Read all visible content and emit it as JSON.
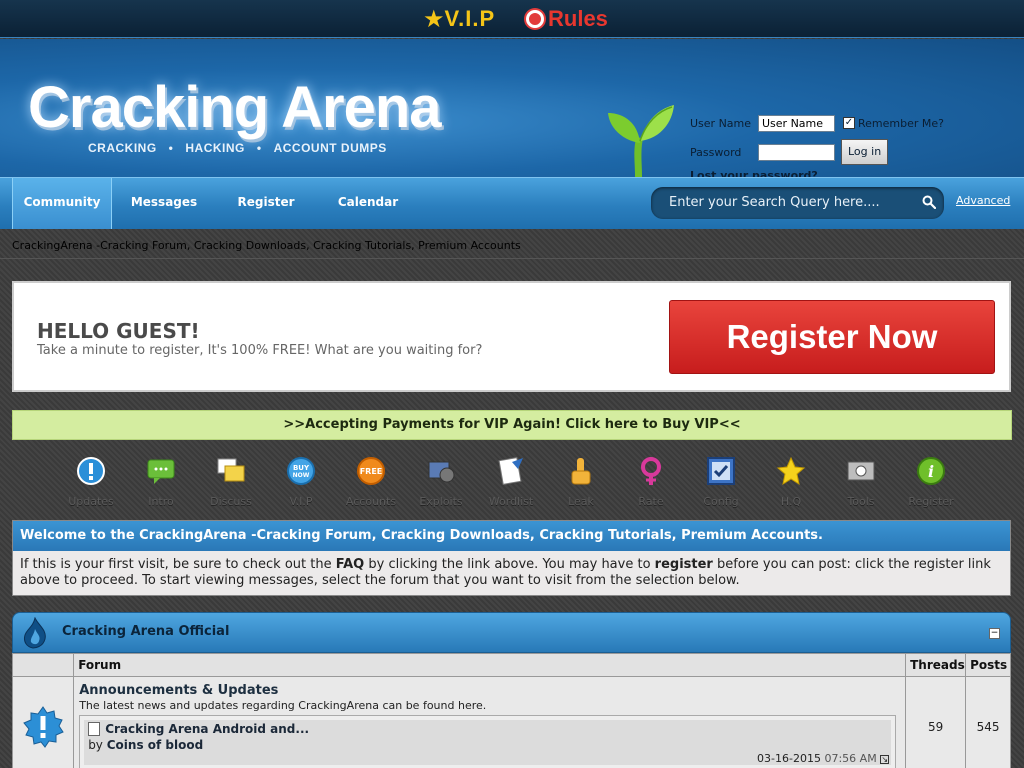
{
  "topbar": {
    "vip": "V.I.P",
    "rules": "Rules"
  },
  "logo": {
    "title": "Cracking Arena",
    "tags": [
      "CRACKING",
      "•",
      "HACKING",
      "•",
      "ACCOUNT DUMPS"
    ]
  },
  "login": {
    "username_label": "User Name",
    "username_value": "User Name",
    "password_label": "Password",
    "remember_label": "Remember Me?",
    "login_button": "Log in",
    "lost_password": "Lost your password?"
  },
  "nav": {
    "tabs": [
      "Community",
      "Messages",
      "Register",
      "Calendar"
    ],
    "search_placeholder": "Enter your Search Query here....",
    "advanced": "Advanced"
  },
  "breadcrumb": "CrackingArena -Cracking Forum, Cracking Downloads, Cracking Tutorials, Premium Accounts",
  "guest": {
    "heading": "HELLO GUEST!",
    "subtext": "Take a minute to register, It's 100% FREE! What are you waiting for?",
    "register_button": "Register Now"
  },
  "vip_banner": ">>Accepting Payments for VIP Again! Click here to Buy VIP<<",
  "icon_row": [
    {
      "label": "Updates",
      "icon": "info-icon"
    },
    {
      "label": "Intro",
      "icon": "chat-icon"
    },
    {
      "label": "Discuss",
      "icon": "discuss-icon"
    },
    {
      "label": "V.I.P",
      "icon": "buy-now-icon"
    },
    {
      "label": "Accounts",
      "icon": "free-icon"
    },
    {
      "label": "Exploits",
      "icon": "exploit-icon"
    },
    {
      "label": "Wordlist",
      "icon": "wordlist-icon"
    },
    {
      "label": "Leak",
      "icon": "leak-icon"
    },
    {
      "label": "Rate",
      "icon": "rate-icon"
    },
    {
      "label": "Config",
      "icon": "config-icon"
    },
    {
      "label": "H.Q",
      "icon": "star-icon"
    },
    {
      "label": "Tools",
      "icon": "tools-icon"
    },
    {
      "label": "Register",
      "icon": "register-icon"
    }
  ],
  "welcome": {
    "title": "Welcome to the CrackingArena -Cracking Forum, Cracking Downloads, Cracking Tutorials, Premium Accounts.",
    "body_1": "If this is your first visit, be sure to check out the ",
    "faq": "FAQ",
    "body_2": " by clicking the link above. You may have to ",
    "register": "register",
    "body_3": " before you can post: click the register link above to proceed. To start viewing messages, select the forum that you want to visit from the selection below."
  },
  "forum": {
    "category": "Cracking Arena Official",
    "collapse": "−",
    "columns": [
      "Forum",
      "Threads",
      "Posts"
    ],
    "rows": [
      {
        "name": "Announcements & Updates",
        "description": "The latest news and updates regarding CrackingArena can be found here.",
        "threads": "59",
        "posts": "545",
        "last_post_title": "Cracking Arena Android and...",
        "last_post_by_label": "by",
        "last_post_by": "Coins of blood",
        "last_post_date": "03-16-2015",
        "last_post_time": "07:56 AM"
      }
    ]
  }
}
